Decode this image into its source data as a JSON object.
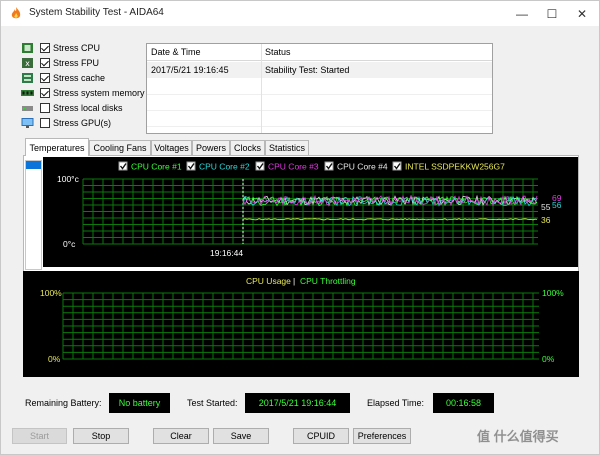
{
  "window": {
    "title": "System Stability Test - AIDA64",
    "controls": {
      "minimize": "—",
      "maximize": "☐",
      "close": "✕"
    }
  },
  "stress_options": [
    {
      "label": "Stress CPU",
      "checked": true,
      "icon": "cpu-chip-icon"
    },
    {
      "label": "Stress FPU",
      "checked": true,
      "icon": "fpu-chip-icon"
    },
    {
      "label": "Stress cache",
      "checked": true,
      "icon": "cache-chip-icon"
    },
    {
      "label": "Stress system memory",
      "checked": true,
      "icon": "memory-module-icon"
    },
    {
      "label": "Stress local disks",
      "checked": false,
      "icon": "disk-drive-icon"
    },
    {
      "label": "Stress GPU(s)",
      "checked": false,
      "icon": "monitor-icon"
    }
  ],
  "log": {
    "columns": [
      "Date & Time",
      "Status"
    ],
    "rows": [
      {
        "datetime": "2017/5/21 19:16:45",
        "status": "Stability Test: Started"
      }
    ]
  },
  "tabs": [
    {
      "label": "Temperatures",
      "active": true
    },
    {
      "label": "Cooling Fans",
      "active": false
    },
    {
      "label": "Voltages",
      "active": false
    },
    {
      "label": "Powers",
      "active": false
    },
    {
      "label": "Clocks",
      "active": false
    },
    {
      "label": "Statistics",
      "active": false
    }
  ],
  "temperature_graph": {
    "legend": [
      {
        "label": "CPU Core #1",
        "checked": true,
        "color": "#39ff39"
      },
      {
        "label": "CPU Core #2",
        "checked": true,
        "color": "#2ad9d9"
      },
      {
        "label": "CPU Core #3",
        "checked": true,
        "color": "#e23ae2"
      },
      {
        "label": "CPU Core #4",
        "checked": true,
        "color": "#e6e6e6"
      },
      {
        "label": "INTEL SSDPEKKW256G7",
        "checked": true,
        "color": "#e8e85a"
      }
    ],
    "y_max_label": "100°c",
    "y_min_label": "0°c",
    "time_marker": "19:16:44",
    "current_values": [
      {
        "value": "69",
        "color": "#e23ae2"
      },
      {
        "value": "55",
        "color": "#e6e6e6"
      },
      {
        "value": "56",
        "color": "#2ad9d9"
      },
      {
        "value": "36",
        "color": "#e8e85a"
      }
    ],
    "grid_color": "#0b7a0b"
  },
  "usage_graph": {
    "title_usage": "CPU Usage",
    "separator": "|",
    "title_throttling": "CPU Throttling",
    "title_usage_color": "#e8e85a",
    "title_throttling_color": "#39ff39",
    "left_max": "100%",
    "left_min": "0%",
    "right_max": "100%",
    "right_min": "0%"
  },
  "status_bar": {
    "battery_label": "Remaining Battery:",
    "battery_value": "No battery",
    "started_label": "Test Started:",
    "started_value": "2017/5/21 19:16:44",
    "elapsed_label": "Elapsed Time:",
    "elapsed_value": "00:16:58"
  },
  "buttons": {
    "start": "Start",
    "stop": "Stop",
    "clear": "Clear",
    "save": "Save",
    "cpuid": "CPUID",
    "preferences": "Preferences"
  },
  "watermark": "值 什么值得买"
}
